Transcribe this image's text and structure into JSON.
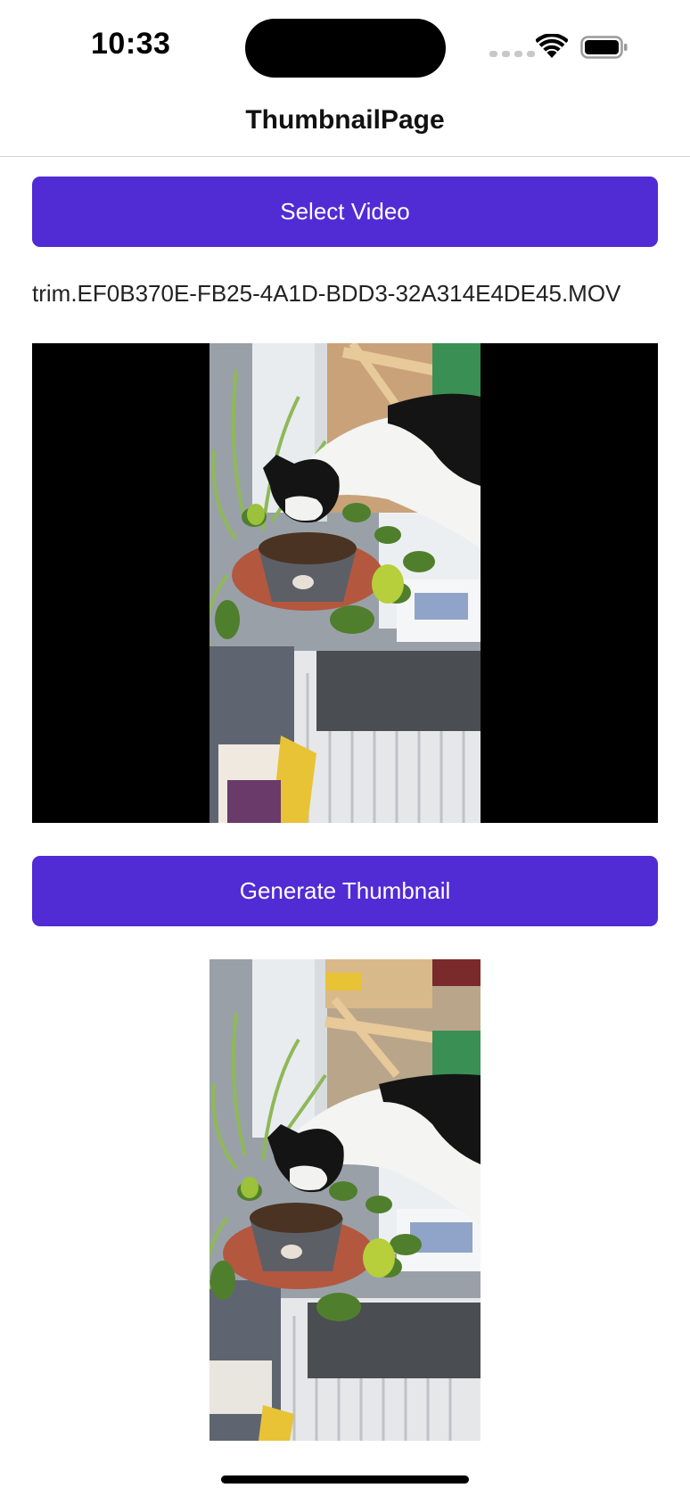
{
  "status_bar": {
    "time": "10:33"
  },
  "nav": {
    "title": "ThumbnailPage"
  },
  "select_button": {
    "label": "Select Video"
  },
  "file": {
    "name": "trim.EF0B370E-FB25-4A1D-BDD3-32A314E4DE45.MOV"
  },
  "generate_button": {
    "label": "Generate Thumbnail"
  },
  "colors": {
    "accent": "#512bd4",
    "video_background": "#000000"
  },
  "icons": {
    "wifi": "wifi-icon",
    "battery": "battery-icon",
    "signal": "cellular-signal-icon"
  }
}
